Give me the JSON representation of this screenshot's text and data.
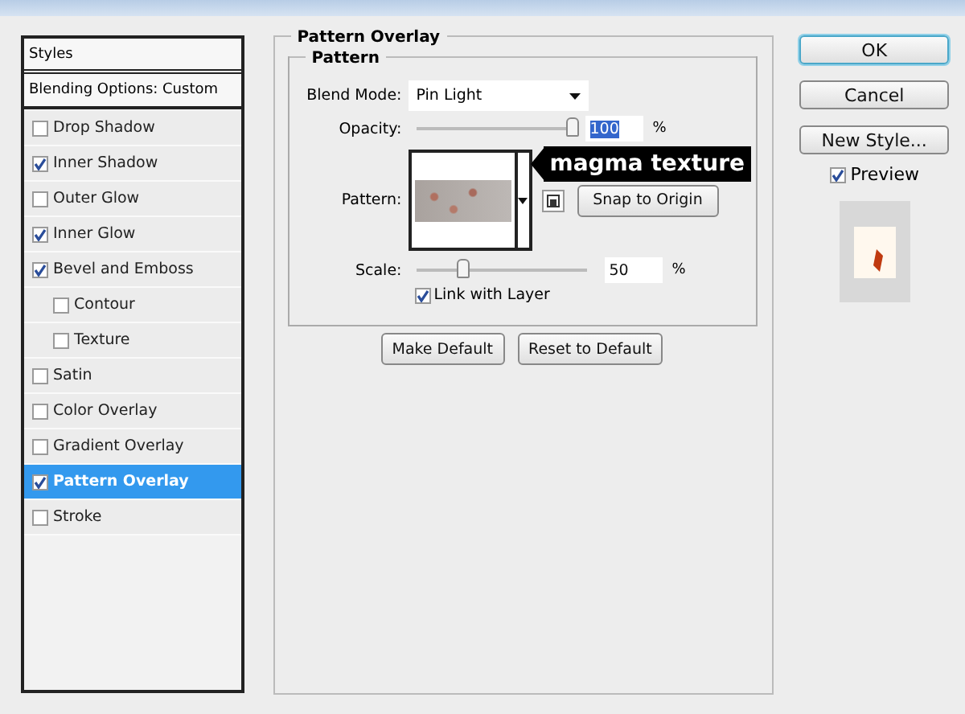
{
  "styles_list": {
    "header": "Styles",
    "blending": "Blending Options: Custom",
    "items": [
      {
        "label": "Drop Shadow",
        "checked": false,
        "selected": false
      },
      {
        "label": "Inner Shadow",
        "checked": true,
        "selected": false
      },
      {
        "label": "Outer Glow",
        "checked": false,
        "selected": false
      },
      {
        "label": "Inner Glow",
        "checked": true,
        "selected": false
      },
      {
        "label": "Bevel and Emboss",
        "checked": true,
        "selected": false,
        "children": [
          {
            "label": "Contour",
            "checked": false,
            "selected": false
          },
          {
            "label": "Texture",
            "checked": false,
            "selected": false
          }
        ]
      },
      {
        "label": "Satin",
        "checked": false,
        "selected": false
      },
      {
        "label": "Color Overlay",
        "checked": false,
        "selected": false
      },
      {
        "label": "Gradient Overlay",
        "checked": false,
        "selected": false
      },
      {
        "label": "Pattern Overlay",
        "checked": true,
        "selected": true
      },
      {
        "label": "Stroke",
        "checked": false,
        "selected": false
      }
    ]
  },
  "panel": {
    "title": "Pattern Overlay",
    "group_title": "Pattern",
    "blend_mode": {
      "label": "Blend Mode:",
      "value": "Pin Light"
    },
    "opacity": {
      "label": "Opacity:",
      "level": 0.97,
      "value": "100",
      "unit": "%"
    },
    "pattern": {
      "label": "Pattern:",
      "snap_button": "Snap to Origin"
    },
    "annotation": "magma texture",
    "scale": {
      "label": "Scale:",
      "level": 0.28,
      "value": "50",
      "unit": "%"
    },
    "link": {
      "label": "Link with Layer",
      "checked": true
    },
    "buttons": [
      "Make Default",
      "Reset to Default"
    ]
  },
  "actions": {
    "ok": "OK",
    "cancel": "Cancel",
    "new_style": "New Style...",
    "preview": {
      "label": "Preview",
      "checked": true
    }
  }
}
